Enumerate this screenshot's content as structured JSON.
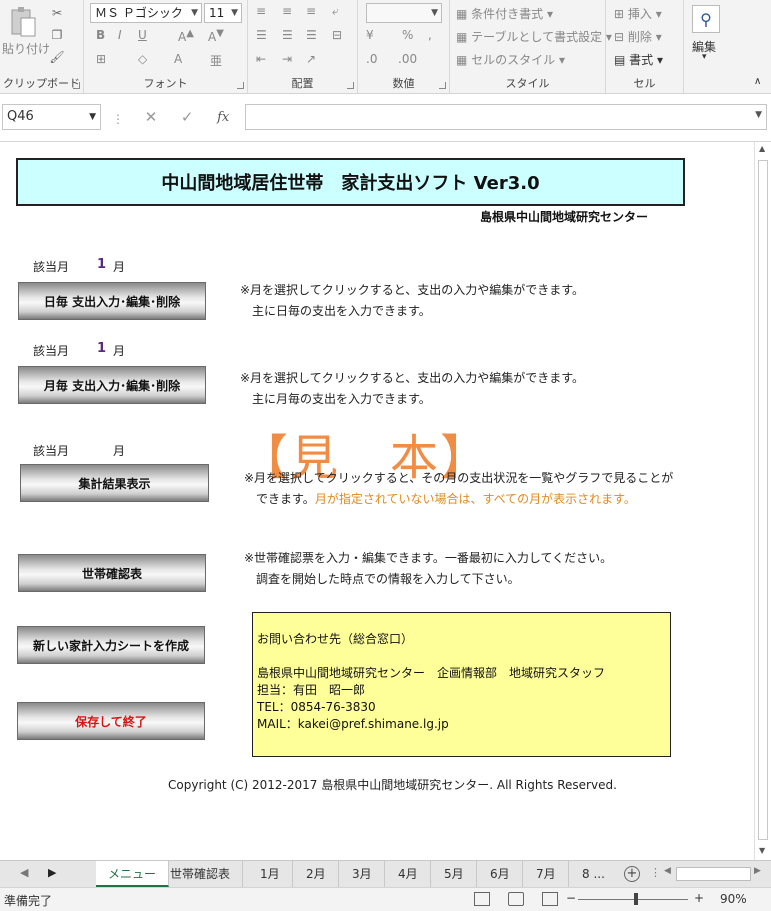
{
  "ribbon": {
    "clipboard": {
      "paste_label": "貼り付け",
      "group_label": "クリップボード"
    },
    "font": {
      "font_name": "ＭＳ Ｐゴシック",
      "font_size": "11",
      "group_label": "フォント"
    },
    "alignment": {
      "group_label": "配置"
    },
    "number": {
      "group_label": "数値"
    },
    "styles": {
      "conditional_label": "条件付き書式",
      "table_label": "テーブルとして書式設定",
      "cell_style_label": "セルのスタイル",
      "group_label": "スタイル"
    },
    "cells": {
      "insert_label": "挿入",
      "delete_label": "削除",
      "format_label": "書式",
      "group_label": "セル"
    },
    "editing": {
      "label": "編集"
    }
  },
  "formula_bar": {
    "name_box": "Q46",
    "formula": ""
  },
  "sheet": {
    "title": "中山間地域居住世帯　家計支出ソフト Ver3.0",
    "org": "島根県中山間地域研究センター",
    "stamp": "【見　本】",
    "sections": [
      {
        "month_label": "該当月",
        "month_num": "1",
        "month_unit": "月",
        "button": "日毎 支出入力･編集･削除",
        "note1": "※月を選択してクリックすると、支出の入力や編集ができます。",
        "note2": "　主に日毎の支出を入力できます。"
      },
      {
        "month_label": "該当月",
        "month_num": "1",
        "month_unit": "月",
        "button": "月毎 支出入力･編集･削除",
        "note1": "※月を選択してクリックすると、支出の入力や編集ができます。",
        "note2": "　主に月毎の支出を入力できます。"
      },
      {
        "month_label": "該当月",
        "month_num": "",
        "month_unit": "月",
        "button": "集計結果表示",
        "note1": "※月を選択してクリックすると、その月の支出状況を一覧やグラフで見ることが",
        "note2a": "　できます。",
        "note2b": "月が指定されていない場合は、すべての月が表示されます。"
      }
    ],
    "household_button": "世帯確認表",
    "household_note1": "※世帯確認票を入力・編集できます。一番最初に入力してください。",
    "household_note2": "　調査を開始した時点での情報を入力して下さい。",
    "new_sheet_button": "新しい家計入力シートを作成",
    "save_button": "保存して終了",
    "contact": {
      "heading": "お問い合わせ先（総合窓口）",
      "line1": "島根県中山間地域研究センター　企画情報部　地域研究スタッフ",
      "line2": "担当：有田　昭一郎",
      "tel": "TEL：0854-76-3830",
      "mail": "MAIL：kakei@pref.shimane.lg.jp"
    },
    "copyright": "Copyright (C) 2012-2017 島根県中山間地域研究センター. All Rights Reserved."
  },
  "tabs": [
    "メニュー",
    "世帯確認表",
    "1月",
    "2月",
    "3月",
    "4月",
    "5月",
    "6月",
    "7月",
    "8 ..."
  ],
  "status": {
    "text": "準備完了",
    "zoom": "90%"
  },
  "colors": {
    "title_bg": "#ccffff",
    "contact_bg": "#ffff99",
    "stamp": "#f08030",
    "accent": "#217346"
  }
}
